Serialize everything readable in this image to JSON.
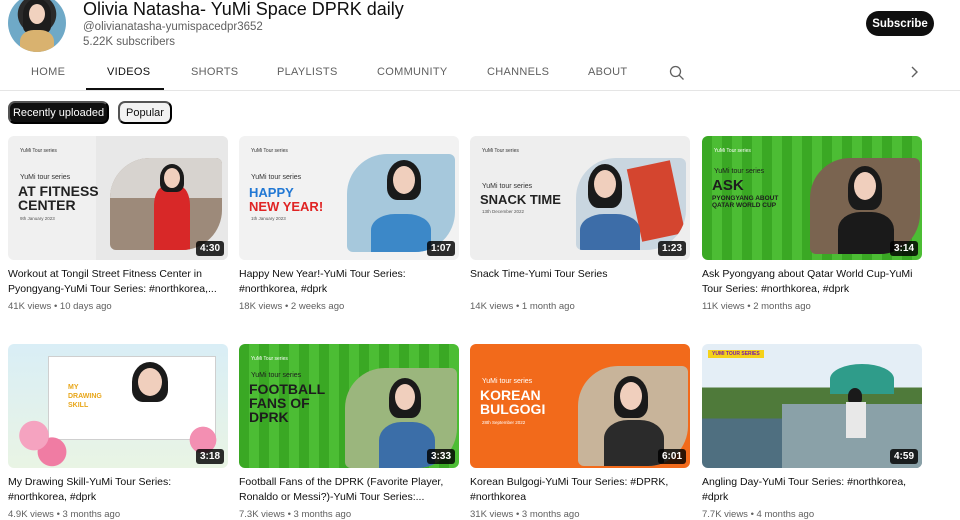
{
  "channel": {
    "title": "Olivia Natasha- YuMi Space DPRK daily",
    "handle": "@olivianatasha-yumispacedpr3652",
    "subscribers": "5.22K subscribers",
    "subscribe_label": "Subscribe"
  },
  "tabs": [
    "HOME",
    "VIDEOS",
    "SHORTS",
    "PLAYLISTS",
    "COMMUNITY",
    "CHANNELS",
    "ABOUT"
  ],
  "active_tab": "VIDEOS",
  "chips": {
    "recent": "Recently uploaded",
    "popular": "Popular"
  },
  "videos": [
    {
      "title": "Workout at Tongil Street Fitness Center in Pyongyang-YuMi Tour Series: #northkorea,...",
      "views": "41K views",
      "age": "10 days ago",
      "duration": "4:30",
      "thumb": {
        "series": "YuMi tour series",
        "big": "AT FITNESS\nCENTER",
        "date": "9th January 2023",
        "brand": "YuMi Tour series"
      }
    },
    {
      "title": "Happy New Year!-YuMi Tour Series: #northkorea, #dprk",
      "views": "18K views",
      "age": "2 weeks ago",
      "duration": "1:07",
      "thumb": {
        "series": "YuMi tour series",
        "big1": "HAPPY",
        "big2": "NEW YEAR!",
        "date": "1th January 2023",
        "brand": "YuMi Tour series"
      }
    },
    {
      "title": "Snack Time-Yumi Tour Series",
      "views": "14K views",
      "age": "1 month ago",
      "duration": "1:23",
      "thumb": {
        "series": "YuMi tour series",
        "big": "SNACK TIME",
        "date": "13th December 2022",
        "brand": "YuMi Tour series"
      }
    },
    {
      "title": "Ask Pyongyang about Qatar World Cup-YuMi Tour Series: #northkorea, #dprk",
      "views": "11K views",
      "age": "2 months ago",
      "duration": "3:14",
      "thumb": {
        "series": "YuMi tour series",
        "big": "ASK",
        "sub": "PYONGYANG ABOUT\nQATAR WORLD CUP",
        "brand": "YuMi Tour series"
      }
    },
    {
      "title": "My Drawing Skill-YuMi Tour Series: #northkorea, #dprk",
      "views": "4.9K views",
      "age": "3 months ago",
      "duration": "3:18",
      "thumb": {
        "big1": "MY",
        "big2": "DRAWING",
        "big3": "SKILL"
      }
    },
    {
      "title": "Football Fans of the DPRK (Favorite Player, Ronaldo or Messi?)-YuMi Tour Series:...",
      "views": "7.3K views",
      "age": "3 months ago",
      "duration": "3:33",
      "thumb": {
        "series": "YuMi tour series",
        "big": "FOOTBALL\nFANS OF\nDPRK",
        "brand": "YuMi Tour series"
      }
    },
    {
      "title": "Korean Bulgogi-YuMi Tour Series: #DPRK, #northkorea",
      "views": "31K views",
      "age": "3 months ago",
      "duration": "6:01",
      "thumb": {
        "series": "YuMi tour series",
        "big": "KOREAN\nBULGOGI",
        "date": "28th September 2022",
        "brand": "YuMi Tour series"
      }
    },
    {
      "title": "Angling Day-YuMi Tour Series: #northkorea, #dprk",
      "views": "7.7K views",
      "age": "4 months ago",
      "duration": "4:59",
      "thumb": {
        "badge": "YUMI TOUR SERIES"
      }
    }
  ],
  "icons": {
    "search": "search-icon",
    "more": "chevron-right-icon"
  },
  "colors": {
    "accent": "#0f0f0f",
    "green": "#3fae2a",
    "orange": "#f26a1b",
    "text_secondary": "#606060"
  }
}
